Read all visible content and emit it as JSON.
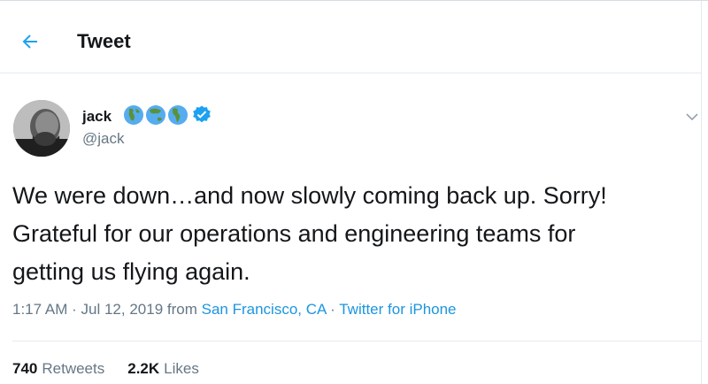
{
  "header": {
    "title": "Tweet",
    "back_icon": "back-arrow-icon"
  },
  "author": {
    "name": "jack",
    "handle": "@jack",
    "badges": [
      "globe-africa-europe-icon",
      "globe-asia-australia-icon",
      "globe-americas-icon",
      "verified-badge-icon"
    ]
  },
  "tweet": {
    "text": "We were down…and now slowly coming back up. Sorry!\nGrateful for our operations and engineering teams for\ngetting us flying again."
  },
  "meta": {
    "time": "1:17 AM",
    "date": "Jul 12, 2019",
    "from_label": "from",
    "location": "San Francisco, CA",
    "source": "Twitter for iPhone",
    "separator": "·"
  },
  "stats": {
    "retweets_count": "740",
    "retweets_label": "Retweets",
    "likes_count": "2.2K",
    "likes_label": "Likes"
  },
  "colors": {
    "link": "#1b95e0",
    "verified": "#1da1f2",
    "secondary_text": "#657786",
    "primary_text": "#14171a"
  }
}
